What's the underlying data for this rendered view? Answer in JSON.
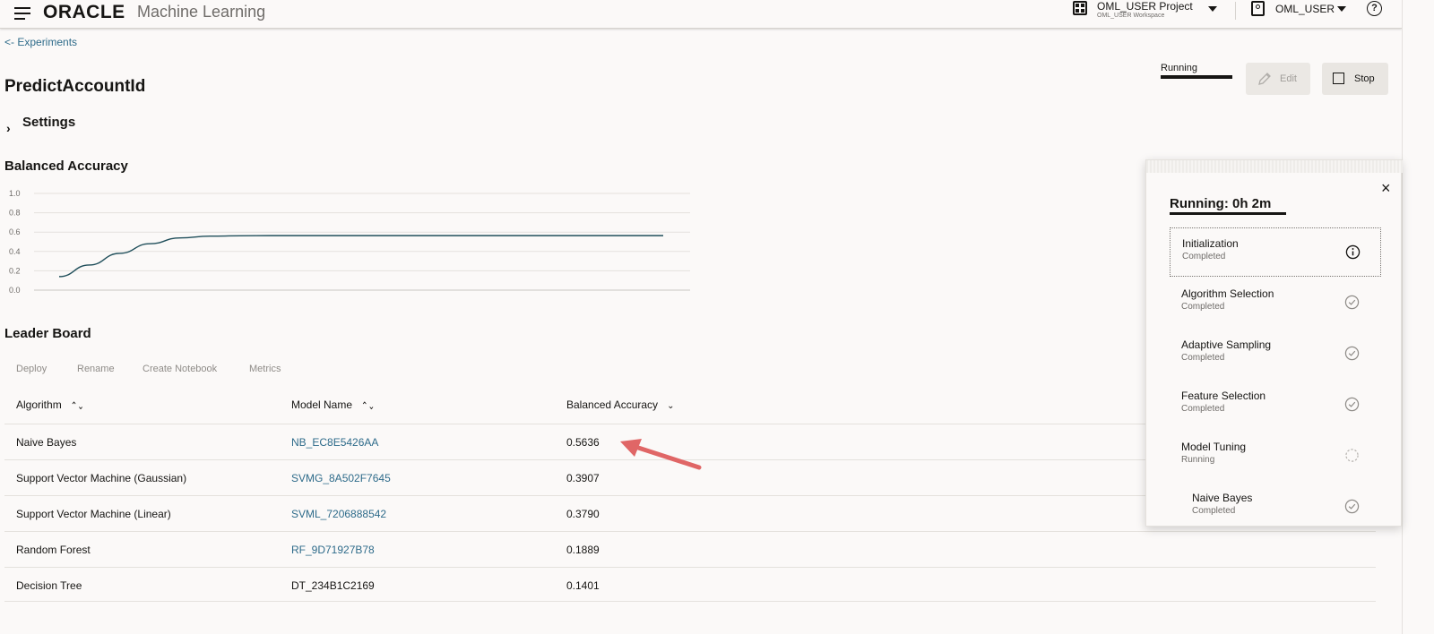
{
  "header": {
    "brand": "ORACLE",
    "product": "Machine Learning",
    "project_name": "OML_USER Project",
    "project_workspace": "OML_USER Workspace",
    "user_name": "OML_USER",
    "help_symbol": "?"
  },
  "breadcrumb": "<- Experiments",
  "experiment": {
    "title": "PredictAccountId",
    "settings_label": "Settings",
    "status_label": "Running",
    "edit_label": "Edit",
    "stop_label": "Stop"
  },
  "chart_section_title": "Balanced Accuracy",
  "chart_data": {
    "type": "line",
    "title": "",
    "xlabel": "",
    "ylabel": "",
    "ylim": [
      0.0,
      1.0
    ],
    "yticks": [
      "1.0",
      "0.8",
      "0.6",
      "0.4",
      "0.2",
      "0.0"
    ],
    "grid": true,
    "series": [
      {
        "x": [
          0,
          1,
          2,
          3,
          4,
          5,
          6,
          7,
          8,
          9,
          10,
          11,
          12,
          13,
          14,
          15,
          16,
          17,
          18,
          19,
          20
        ],
        "values": [
          0.14,
          0.26,
          0.38,
          0.48,
          0.54,
          0.558,
          0.562,
          0.5636,
          0.5636,
          0.5636,
          0.5636,
          0.5636,
          0.5636,
          0.5636,
          0.5636,
          0.5636,
          0.5636,
          0.5636,
          0.5636,
          0.5636,
          0.5636
        ],
        "color": "#1f4e5a"
      }
    ]
  },
  "leaderboard": {
    "title": "Leader Board",
    "actions": [
      "Deploy",
      "Rename",
      "Create Notebook",
      "Metrics"
    ],
    "columns": [
      "Algorithm",
      "Model Name",
      "Balanced Accuracy"
    ],
    "rows": [
      {
        "algorithm": "Naive Bayes",
        "model": "NB_EC8E5426AA",
        "accuracy": "0.5636",
        "model_link": true
      },
      {
        "algorithm": "Support Vector Machine (Gaussian)",
        "model": "SVMG_8A502F7645",
        "accuracy": "0.3907",
        "model_link": true
      },
      {
        "algorithm": "Support Vector Machine (Linear)",
        "model": "SVML_7206888542",
        "accuracy": "0.3790",
        "model_link": true
      },
      {
        "algorithm": "Random Forest",
        "model": "RF_9D71927B78",
        "accuracy": "0.1889",
        "model_link": true
      },
      {
        "algorithm": "Decision Tree",
        "model": "DT_234B1C2169",
        "accuracy": "0.1401",
        "model_link": false
      }
    ]
  },
  "progress_panel": {
    "title": "Running: 0h 2m",
    "close_symbol": "×",
    "steps": [
      {
        "name": "Initialization",
        "status": "Completed",
        "icon": "info-icon"
      },
      {
        "name": "Algorithm Selection",
        "status": "Completed",
        "icon": "check-circle-icon"
      },
      {
        "name": "Adaptive Sampling",
        "status": "Completed",
        "icon": "check-circle-icon"
      },
      {
        "name": "Feature Selection",
        "status": "Completed",
        "icon": "check-circle-icon"
      },
      {
        "name": "Model Tuning",
        "status": "Running",
        "icon": "spinner-icon"
      },
      {
        "name": "Naive Bayes",
        "status": "Completed",
        "icon": "check-circle-icon"
      }
    ]
  },
  "colors": {
    "link": "#2e6b8a",
    "chart_line": "#1f4e5a",
    "annotation_arrow": "#e06666"
  }
}
